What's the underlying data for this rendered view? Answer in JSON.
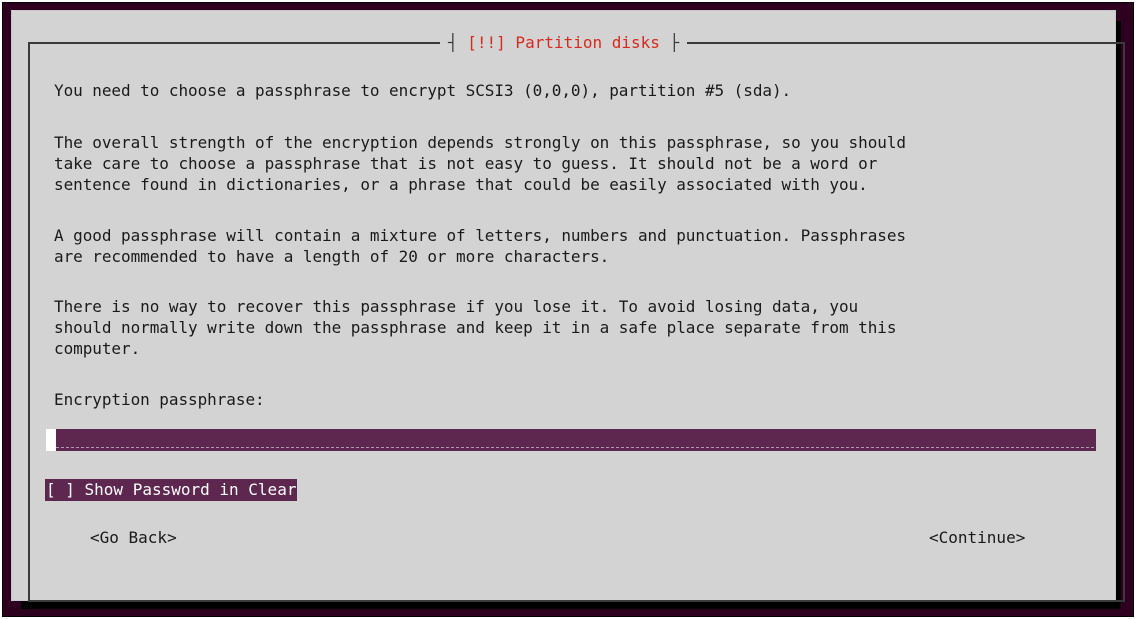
{
  "dialog": {
    "title": "[!!] Partition disks",
    "paragraphs": [
      "You need to choose a passphrase to encrypt SCSI3 (0,0,0), partition #5 (sda).",
      "The overall strength of the encryption depends strongly on this passphrase, so you should",
      "take care to choose a passphrase that is not easy to guess. It should not be a word or",
      "sentence found in dictionaries, or a phrase that could be easily associated with you.",
      "A good passphrase will contain a mixture of letters, numbers and punctuation. Passphrases",
      "are recommended to have a length of 20 or more characters.",
      "There is no way to recover this passphrase if you lose it. To avoid losing data, you",
      "should normally write down the passphrase and keep it in a safe place separate from this",
      "computer."
    ],
    "field_label": "Encryption passphrase:",
    "passphrase_value": "",
    "checkbox_label": "[ ] Show Password in Clear",
    "buttons": {
      "back": "<Go Back>",
      "continue": "<Continue>"
    }
  },
  "colors": {
    "background": "#2c001e",
    "dialog": "#d3d3d3",
    "highlight": "#5e2750",
    "title": "#d9281d"
  }
}
